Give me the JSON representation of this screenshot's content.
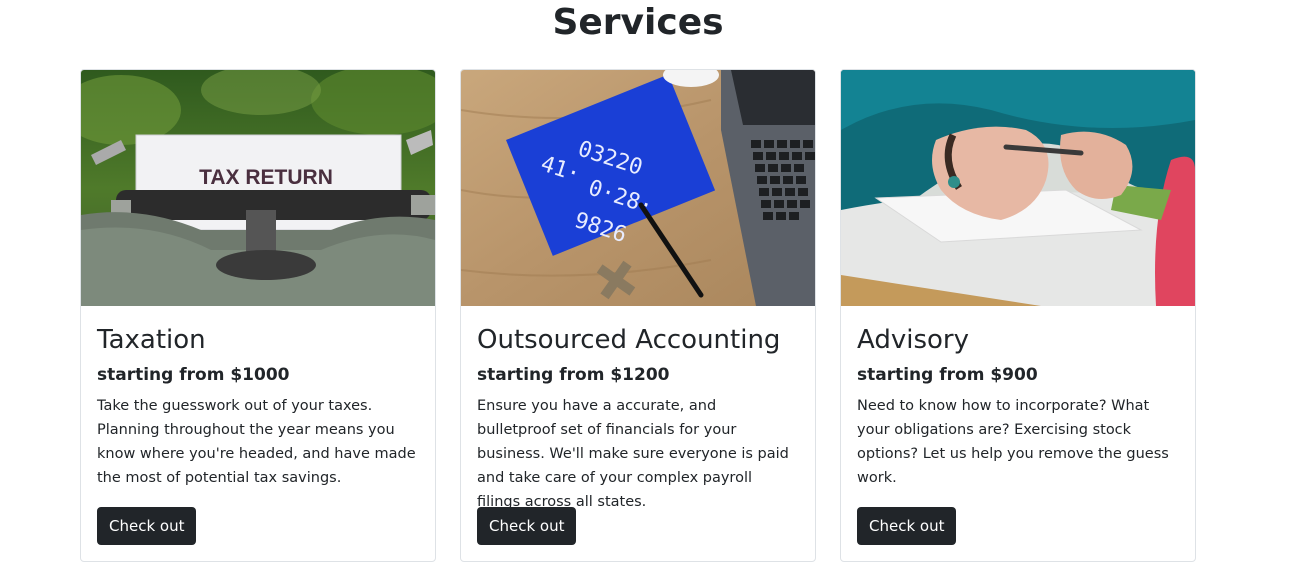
{
  "header": {
    "title": "Services"
  },
  "cards": [
    {
      "title": "Taxation",
      "price": "starting from $1000",
      "description": "Take the guesswork out of your taxes. Planning throughout the year means you know where you're headed, and have made the most of potential tax savings.",
      "button_label": "Check out",
      "image": {
        "icon": "typewriter-image",
        "text": "TAX RETURN"
      }
    },
    {
      "title": "Outsourced Accounting",
      "price": "starting from $1200",
      "description": "Ensure you have a accurate, and bulletproof set of financials for your business. We'll make sure everyone is paid and take care of your complex payroll filings across all states.",
      "button_label": "Check out",
      "image": {
        "icon": "desk-notebook-laptop-image"
      }
    },
    {
      "title": "Advisory",
      "price": "starting from $900",
      "description": "Need to know how to incorporate? What your obligations are? Exercising stock options? Let us help you remove the guess work.",
      "button_label": "Check out",
      "image": {
        "icon": "hands-writing-image"
      }
    }
  ],
  "colors": {
    "button_bg": "#212529",
    "text": "#212529",
    "border": "#dee2e6"
  }
}
